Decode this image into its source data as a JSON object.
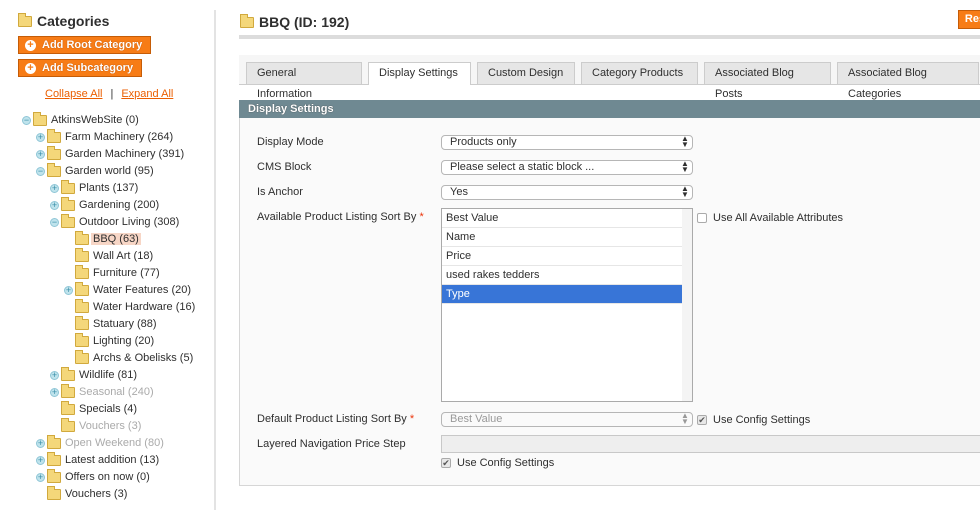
{
  "sidebar": {
    "title": "Categories",
    "add_root_label": "Add Root Category",
    "add_sub_label": "Add Subcategory",
    "collapse_all": "Collapse All",
    "expand_all": "Expand All",
    "separator": "|",
    "tree": [
      {
        "label": "AtkinsWebSite (0)",
        "level": 0,
        "toggle": "minus"
      },
      {
        "label": "Farm Machinery (264)",
        "level": 1,
        "toggle": "plus"
      },
      {
        "label": "Garden Machinery (391)",
        "level": 1,
        "toggle": "plus"
      },
      {
        "label": "Garden world (95)",
        "level": 1,
        "toggle": "minus"
      },
      {
        "label": "Plants (137)",
        "level": 2,
        "toggle": "plus"
      },
      {
        "label": "Gardening (200)",
        "level": 2,
        "toggle": "plus"
      },
      {
        "label": "Outdoor Living (308)",
        "level": 2,
        "toggle": "minus"
      },
      {
        "label": "BBQ (63)",
        "level": 3,
        "toggle": "none",
        "selected": true
      },
      {
        "label": "Wall Art (18)",
        "level": 3,
        "toggle": "none"
      },
      {
        "label": "Furniture (77)",
        "level": 3,
        "toggle": "none"
      },
      {
        "label": "Water Features (20)",
        "level": 3,
        "toggle": "plus"
      },
      {
        "label": "Water Hardware (16)",
        "level": 3,
        "toggle": "none"
      },
      {
        "label": "Statuary (88)",
        "level": 3,
        "toggle": "none"
      },
      {
        "label": "Lighting (20)",
        "level": 3,
        "toggle": "none"
      },
      {
        "label": "Archs & Obelisks (5)",
        "level": 3,
        "toggle": "none"
      },
      {
        "label": "Wildlife (81)",
        "level": 2,
        "toggle": "plus"
      },
      {
        "label": "Seasonal (240)",
        "level": 2,
        "toggle": "plus",
        "disabled": true
      },
      {
        "label": "Specials (4)",
        "level": 2,
        "toggle": "none"
      },
      {
        "label": "Vouchers (3)",
        "level": 2,
        "toggle": "none",
        "disabled": true
      },
      {
        "label": "Open Weekend (80)",
        "level": 1,
        "toggle": "plus",
        "disabled": true
      },
      {
        "label": "Latest addition (13)",
        "level": 1,
        "toggle": "plus"
      },
      {
        "label": "Offers on now (0)",
        "level": 1,
        "toggle": "plus"
      },
      {
        "label": "Vouchers (3)",
        "level": 1,
        "toggle": "none"
      }
    ]
  },
  "header": {
    "title": "BBQ (ID: 192)",
    "reset_label": "Res"
  },
  "tabs": [
    {
      "label": "General Information"
    },
    {
      "label": "Display Settings",
      "active": true
    },
    {
      "label": "Custom Design"
    },
    {
      "label": "Category Products"
    },
    {
      "label": "Associated Blog Posts"
    },
    {
      "label": "Associated Blog Categories"
    }
  ],
  "section": {
    "title": "Display Settings",
    "display_mode": {
      "label": "Display Mode",
      "value": "Products only"
    },
    "cms_block": {
      "label": "CMS Block",
      "value": "Please select a static block ..."
    },
    "is_anchor": {
      "label": "Is Anchor",
      "value": "Yes"
    },
    "available_sort": {
      "label": "Available Product Listing Sort By",
      "required": "*",
      "options": [
        "Best Value",
        "Name",
        "Price",
        "used rakes tedders",
        "Type"
      ],
      "selected": "Type",
      "use_all_label": "Use All Available Attributes",
      "use_all_checked": false
    },
    "default_sort": {
      "label": "Default Product Listing Sort By",
      "required": "*",
      "value": "Best Value",
      "use_config_label": "Use Config Settings",
      "use_config_checked": true
    },
    "price_step": {
      "label": "Layered Navigation Price Step",
      "value": "",
      "use_config_label": "Use Config Settings",
      "use_config_checked": true
    }
  },
  "colors": {
    "accent": "#f77c16",
    "section_header": "#6f8992",
    "selected_option": "#3875d7",
    "tree_selected": "#f7d6c6"
  }
}
